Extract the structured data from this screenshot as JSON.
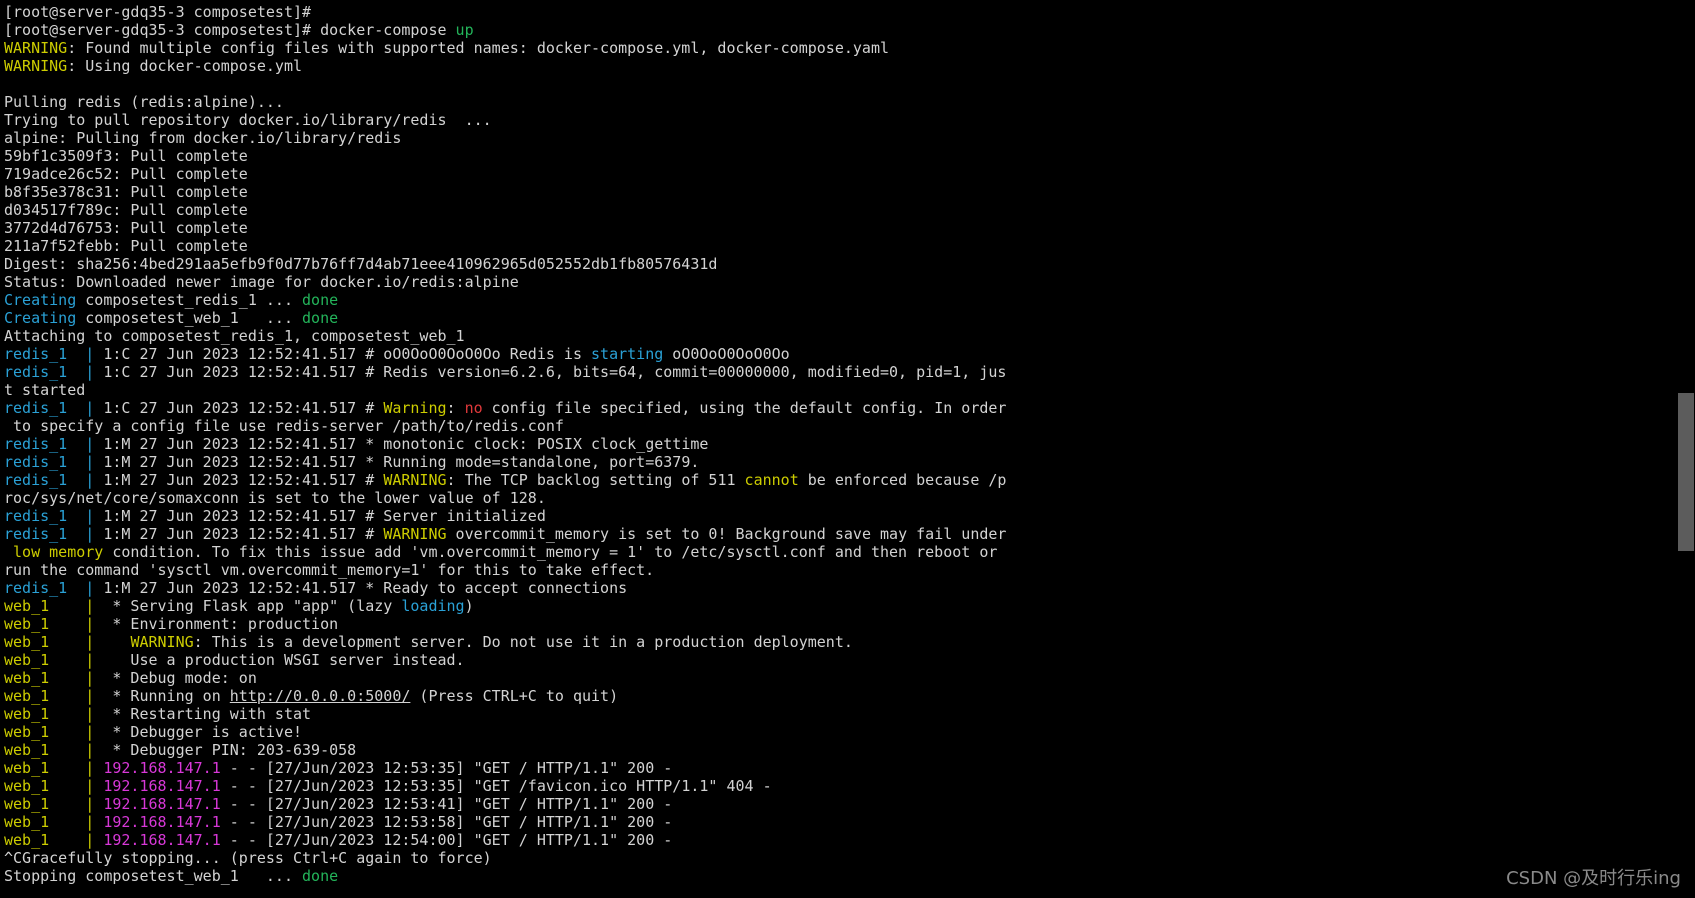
{
  "terminal": {
    "lines": [
      [
        {
          "t": "[root@server-gdq35-3 composetest]#",
          "c": "white"
        }
      ],
      [
        {
          "t": "[root@server-gdq35-3 composetest]# docker-compose ",
          "c": "white"
        },
        {
          "t": "up",
          "c": "green"
        }
      ],
      [
        {
          "t": "WARNING",
          "c": "yellow"
        },
        {
          "t": ": Found multiple config files with supported names: docker-compose.yml, docker-compose.yaml",
          "c": "white"
        }
      ],
      [
        {
          "t": "WARNING",
          "c": "yellow"
        },
        {
          "t": ": Using docker-compose.yml",
          "c": "white"
        }
      ],
      [],
      [
        {
          "t": "Pulling redis (redis:alpine)...",
          "c": "white"
        }
      ],
      [
        {
          "t": "Trying to pull repository docker.io/library/redis  ...",
          "c": "white"
        }
      ],
      [
        {
          "t": "alpine: Pulling from docker.io/library/redis",
          "c": "white"
        }
      ],
      [
        {
          "t": "59bf1c3509f3: Pull complete",
          "c": "white"
        }
      ],
      [
        {
          "t": "719adce26c52: Pull complete",
          "c": "white"
        }
      ],
      [
        {
          "t": "b8f35e378c31: Pull complete",
          "c": "white"
        }
      ],
      [
        {
          "t": "d034517f789c: Pull complete",
          "c": "white"
        }
      ],
      [
        {
          "t": "3772d4d76753: Pull complete",
          "c": "white"
        }
      ],
      [
        {
          "t": "211a7f52febb: Pull complete",
          "c": "white"
        }
      ],
      [
        {
          "t": "Digest: sha256:4bed291aa5efb9f0d77b76ff7d4ab71eee410962965d052552db1fb80576431d",
          "c": "white"
        }
      ],
      [
        {
          "t": "Status: Downloaded newer image for docker.io/redis:alpine",
          "c": "white"
        }
      ],
      [
        {
          "t": "Creating",
          "c": "cyan"
        },
        {
          "t": " composetest_redis_1 ... ",
          "c": "white"
        },
        {
          "t": "done",
          "c": "green"
        }
      ],
      [
        {
          "t": "Creating",
          "c": "cyan"
        },
        {
          "t": " composetest_web_1   ... ",
          "c": "white"
        },
        {
          "t": "done",
          "c": "green"
        }
      ],
      [
        {
          "t": "Attaching to composetest_redis_1, composetest_web_1",
          "c": "white"
        }
      ],
      [
        {
          "t": "redis_1  | ",
          "c": "cyan"
        },
        {
          "t": "1:C 27 Jun 2023 12:52:41.517 # oO0OoO0OoO0Oo Redis is ",
          "c": "white"
        },
        {
          "t": "starting",
          "c": "cyan"
        },
        {
          "t": " oO0OoO0OoO0Oo",
          "c": "white"
        }
      ],
      [
        {
          "t": "redis_1  | ",
          "c": "cyan"
        },
        {
          "t": "1:C 27 Jun 2023 12:52:41.517 # Redis version=6.2.6, bits=64, commit=00000000, modified=0, pid=1, jus",
          "c": "white"
        }
      ],
      [
        {
          "t": "t started",
          "c": "white"
        }
      ],
      [
        {
          "t": "redis_1  | ",
          "c": "cyan"
        },
        {
          "t": "1:C 27 Jun 2023 12:52:41.517 # ",
          "c": "white"
        },
        {
          "t": "Warning",
          "c": "yellow"
        },
        {
          "t": ": ",
          "c": "white"
        },
        {
          "t": "no",
          "c": "red"
        },
        {
          "t": " config file specified, using the default config. In order",
          "c": "white"
        }
      ],
      [
        {
          "t": " to specify a config file use redis-server /path/to/redis.conf",
          "c": "white"
        }
      ],
      [
        {
          "t": "redis_1  | ",
          "c": "cyan"
        },
        {
          "t": "1:M 27 Jun 2023 12:52:41.517 * monotonic clock: POSIX clock_gettime",
          "c": "white"
        }
      ],
      [
        {
          "t": "redis_1  | ",
          "c": "cyan"
        },
        {
          "t": "1:M 27 Jun 2023 12:52:41.517 * Running mode=standalone, port=6379.",
          "c": "white"
        }
      ],
      [
        {
          "t": "redis_1  | ",
          "c": "cyan"
        },
        {
          "t": "1:M 27 Jun 2023 12:52:41.517 # ",
          "c": "white"
        },
        {
          "t": "WARNING",
          "c": "yellow"
        },
        {
          "t": ": The TCP backlog setting of 511 ",
          "c": "white"
        },
        {
          "t": "cannot",
          "c": "yellow"
        },
        {
          "t": " be enforced because /p",
          "c": "white"
        }
      ],
      [
        {
          "t": "roc/sys/net/core/somaxconn is set to the lower value of 128.",
          "c": "white"
        }
      ],
      [
        {
          "t": "redis_1  | ",
          "c": "cyan"
        },
        {
          "t": "1:M 27 Jun 2023 12:52:41.517 # Server initialized",
          "c": "white"
        }
      ],
      [
        {
          "t": "redis_1  | ",
          "c": "cyan"
        },
        {
          "t": "1:M 27 Jun 2023 12:52:41.517 # ",
          "c": "white"
        },
        {
          "t": "WARNING",
          "c": "yellow"
        },
        {
          "t": " overcommit_memory is set to 0! Background save may fail under",
          "c": "white"
        }
      ],
      [
        {
          "t": " ",
          "c": "white"
        },
        {
          "t": "low memory",
          "c": "yellow"
        },
        {
          "t": " condition. To fix this issue add 'vm.overcommit_memory = 1' to /etc/sysctl.conf and then reboot or",
          "c": "white"
        }
      ],
      [
        {
          "t": "run the command 'sysctl vm.overcommit_memory=1' for this to take effect.",
          "c": "white"
        }
      ],
      [
        {
          "t": "redis_1  | ",
          "c": "cyan"
        },
        {
          "t": "1:M 27 Jun 2023 12:52:41.517 * Ready to accept connections",
          "c": "white"
        }
      ],
      [
        {
          "t": "web_1    | ",
          "c": "yellow"
        },
        {
          "t": " * Serving Flask app \"app\" (lazy ",
          "c": "white"
        },
        {
          "t": "loading",
          "c": "cyan"
        },
        {
          "t": ")",
          "c": "white"
        }
      ],
      [
        {
          "t": "web_1    | ",
          "c": "yellow"
        },
        {
          "t": " * Environment: production",
          "c": "white"
        }
      ],
      [
        {
          "t": "web_1    | ",
          "c": "yellow"
        },
        {
          "t": "   ",
          "c": "white"
        },
        {
          "t": "WARNING",
          "c": "yellow"
        },
        {
          "t": ": This is a development server. Do not use it in a production deployment.",
          "c": "white"
        }
      ],
      [
        {
          "t": "web_1    | ",
          "c": "yellow"
        },
        {
          "t": "   Use a production WSGI server instead.",
          "c": "white"
        }
      ],
      [
        {
          "t": "web_1    | ",
          "c": "yellow"
        },
        {
          "t": " * Debug mode: on",
          "c": "white"
        }
      ],
      [
        {
          "t": "web_1    | ",
          "c": "yellow"
        },
        {
          "t": " * Running on ",
          "c": "white"
        },
        {
          "t": "http://0.0.0.0:5000/",
          "c": "white",
          "u": true
        },
        {
          "t": " (Press CTRL+C to quit)",
          "c": "white"
        }
      ],
      [
        {
          "t": "web_1    | ",
          "c": "yellow"
        },
        {
          "t": " * Restarting with stat",
          "c": "white"
        }
      ],
      [
        {
          "t": "web_1    | ",
          "c": "yellow"
        },
        {
          "t": " * Debugger is active!",
          "c": "white"
        }
      ],
      [
        {
          "t": "web_1    | ",
          "c": "yellow"
        },
        {
          "t": " * Debugger PIN: 203-639-058",
          "c": "white"
        }
      ],
      [
        {
          "t": "web_1    | ",
          "c": "yellow"
        },
        {
          "t": "192.168.147.1",
          "c": "magenta"
        },
        {
          "t": " - - [27/Jun/2023 12:53:35] \"GET / HTTP/1.1\" 200 -",
          "c": "white"
        }
      ],
      [
        {
          "t": "web_1    | ",
          "c": "yellow"
        },
        {
          "t": "192.168.147.1",
          "c": "magenta"
        },
        {
          "t": " - - [27/Jun/2023 12:53:35] \"GET /favicon.ico HTTP/1.1\" 404 -",
          "c": "white"
        }
      ],
      [
        {
          "t": "web_1    | ",
          "c": "yellow"
        },
        {
          "t": "192.168.147.1",
          "c": "magenta"
        },
        {
          "t": " - - [27/Jun/2023 12:53:41] \"GET / HTTP/1.1\" 200 -",
          "c": "white"
        }
      ],
      [
        {
          "t": "web_1    | ",
          "c": "yellow"
        },
        {
          "t": "192.168.147.1",
          "c": "magenta"
        },
        {
          "t": " - - [27/Jun/2023 12:53:58] \"GET / HTTP/1.1\" 200 -",
          "c": "white"
        }
      ],
      [
        {
          "t": "web_1    | ",
          "c": "yellow"
        },
        {
          "t": "192.168.147.1",
          "c": "magenta"
        },
        {
          "t": " - - [27/Jun/2023 12:54:00] \"GET / HTTP/1.1\" 200 -",
          "c": "white"
        }
      ],
      [
        {
          "t": "^CGracefully stopping... (press Ctrl+C again to force)",
          "c": "white"
        }
      ],
      [
        {
          "t": "Stopping composetest_web_1   ... ",
          "c": "white"
        },
        {
          "t": "done",
          "c": "green"
        }
      ]
    ],
    "colors": {
      "background": "#000000",
      "white": "#d3d3d3",
      "cyan": "#2aa1d6",
      "green": "#23b45a",
      "yellow": "#cdcd00",
      "red": "#e0393b",
      "magenta": "#d838d8"
    }
  },
  "scrollbar": {
    "position_fraction": 0.47
  },
  "watermark": {
    "text": "CSDN @及时行乐ing"
  }
}
